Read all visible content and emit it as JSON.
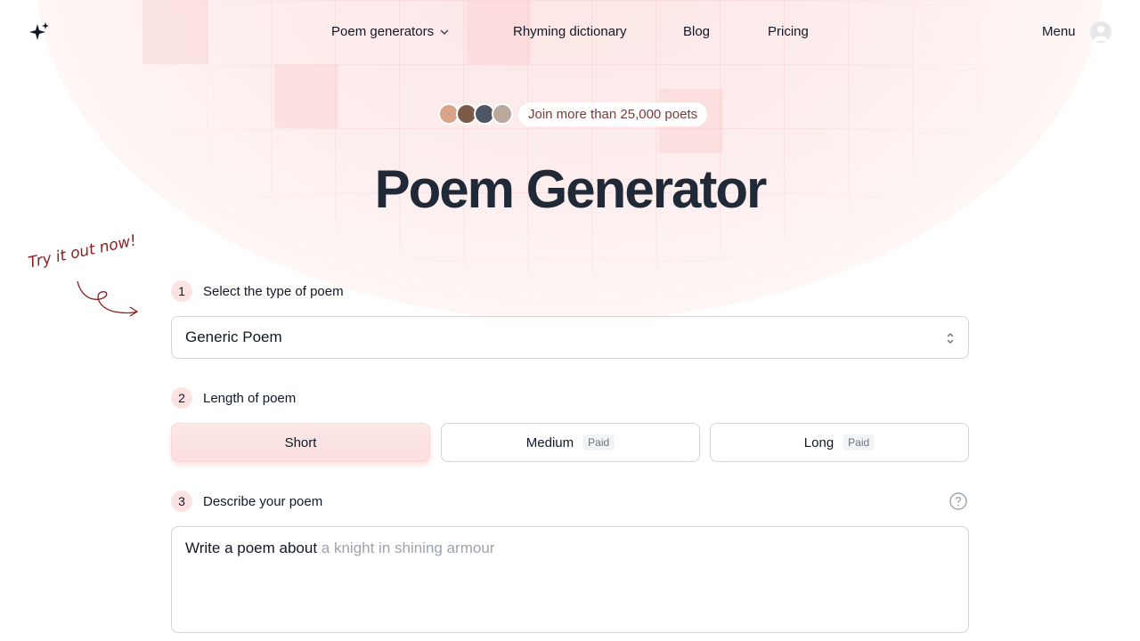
{
  "header": {
    "logo_icon": "sparkles-icon",
    "nav": [
      {
        "label": "Poem generators",
        "has_dropdown": true
      },
      {
        "label": "Rhyming dictionary"
      },
      {
        "label": "Blog"
      },
      {
        "label": "Pricing"
      }
    ],
    "menu_label": "Menu",
    "avatar_icon": "user-avatar-icon"
  },
  "hero": {
    "join_text": "Join more than 25,000 poets",
    "title": "Poem Generator",
    "try_it": "Try it out now!"
  },
  "steps": [
    {
      "number": "1",
      "label": "Select the type of poem"
    },
    {
      "number": "2",
      "label": "Length of poem"
    },
    {
      "number": "3",
      "label": "Describe your poem"
    }
  ],
  "poem_type": {
    "selected": "Generic Poem"
  },
  "lengths": [
    {
      "label": "Short",
      "badge": "",
      "active": true
    },
    {
      "label": "Medium",
      "badge": "Paid",
      "active": false
    },
    {
      "label": "Long",
      "badge": "Paid",
      "active": false
    }
  ],
  "description": {
    "prefix": "Write a poem about",
    "placeholder": "a knight in shining armour"
  },
  "colors": {
    "accent_pink": "#fde2e2",
    "title_dark": "#1f2937",
    "handwriting_red": "#8b1e1e"
  }
}
